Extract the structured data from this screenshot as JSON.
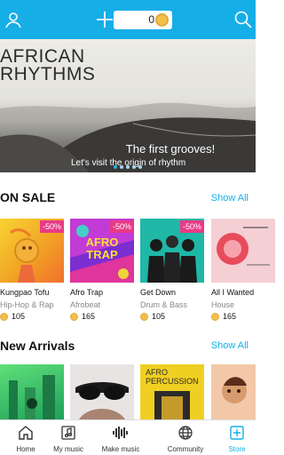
{
  "topbar": {
    "coins": "0",
    "accent": "#16aee6"
  },
  "banner": {
    "title_line1": "AFRICAN",
    "title_line2": "RHYTHMS",
    "subtitle": "The first grooves!",
    "caption": "Let's visit the origin of rhythm",
    "dots": 5,
    "active_dot": 0
  },
  "on_sale": {
    "title": "ON SALE",
    "show_all": "Show All",
    "items": [
      {
        "name": "Kungpao Tofu",
        "genre": "Hip-Hop & Rap",
        "price": "105",
        "discount": "-50%"
      },
      {
        "name": "Afro Trap",
        "genre": "Afrobeat",
        "price": "165",
        "discount": "-50%",
        "art_text": "AFRO TRAP"
      },
      {
        "name": "Get Down",
        "genre": "Drum & Bass",
        "price": "105",
        "discount": "-50%"
      },
      {
        "name": "All I Wanted",
        "genre": "House",
        "price": "165",
        "discount": ""
      }
    ]
  },
  "new_arrivals": {
    "title": "New Arrivals",
    "show_all": "Show All",
    "items": [
      {
        "art_text": ""
      },
      {
        "art_text": ""
      },
      {
        "art_text": "AFRO PERCUSSION"
      },
      {
        "art_text": ""
      }
    ]
  },
  "nav": {
    "items": [
      {
        "label": "Home",
        "icon": "home-icon"
      },
      {
        "label": "My music",
        "icon": "music-note-icon"
      },
      {
        "label": "Make music",
        "icon": "waveform-icon"
      },
      {
        "label": "Community",
        "icon": "globe-icon"
      },
      {
        "label": "Store",
        "icon": "store-plus-icon",
        "active": true
      }
    ]
  }
}
